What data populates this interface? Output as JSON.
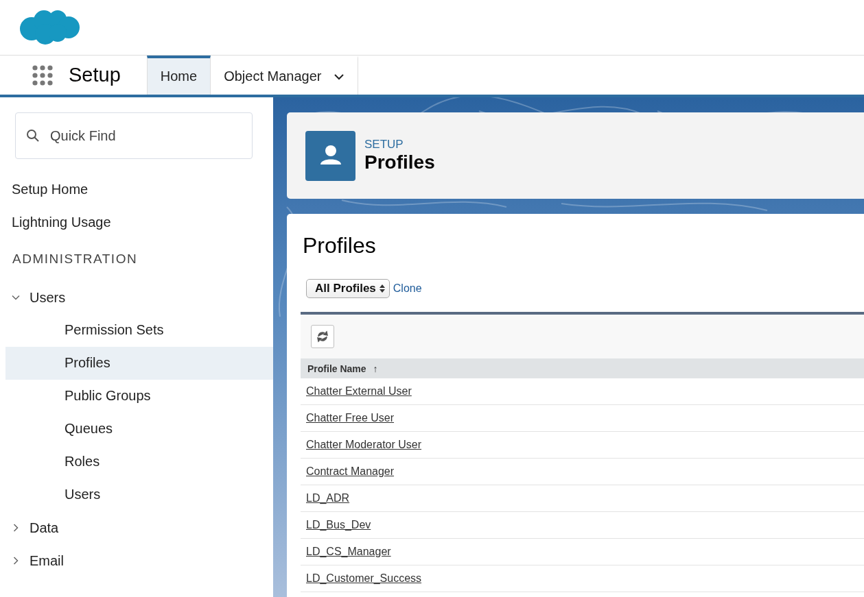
{
  "app_bar": {
    "app_name": "Setup",
    "tabs": [
      {
        "label": "Home",
        "selected": true,
        "kind": "plain"
      },
      {
        "label": "Object Manager",
        "selected": false,
        "kind": "menu"
      }
    ]
  },
  "sidebar": {
    "search": {
      "placeholder": "Quick Find"
    },
    "links": [
      {
        "label": "Setup Home",
        "selected": false
      },
      {
        "label": "Lightning Usage",
        "selected": false
      }
    ],
    "sections": [
      {
        "heading": "ADMINISTRATION",
        "items": [
          {
            "label": "Users",
            "expanded": true,
            "children": [
              {
                "label": "Permission Sets",
                "selected": false
              },
              {
                "label": "Profiles",
                "selected": true
              },
              {
                "label": "Public Groups",
                "selected": false
              },
              {
                "label": "Queues",
                "selected": false
              },
              {
                "label": "Roles",
                "selected": false
              },
              {
                "label": "Users",
                "selected": false
              }
            ]
          },
          {
            "label": "Data",
            "expanded": false
          },
          {
            "label": "Email",
            "expanded": false
          }
        ]
      }
    ]
  },
  "page_header": {
    "eyebrow": "SETUP",
    "title": "Profiles"
  },
  "content": {
    "title": "Profiles",
    "view_select": "All Profiles",
    "clone_link": "Clone",
    "table": {
      "columns": [
        {
          "label": "Profile Name",
          "sort": "↑"
        }
      ],
      "rows": [
        "Chatter External User",
        "Chatter Free User",
        "Chatter Moderator User",
        "Contract Manager",
        "LD_ADR",
        "LD_Bus_Dev",
        "LD_CS_Manager",
        "LD_Customer_Success"
      ]
    }
  }
}
